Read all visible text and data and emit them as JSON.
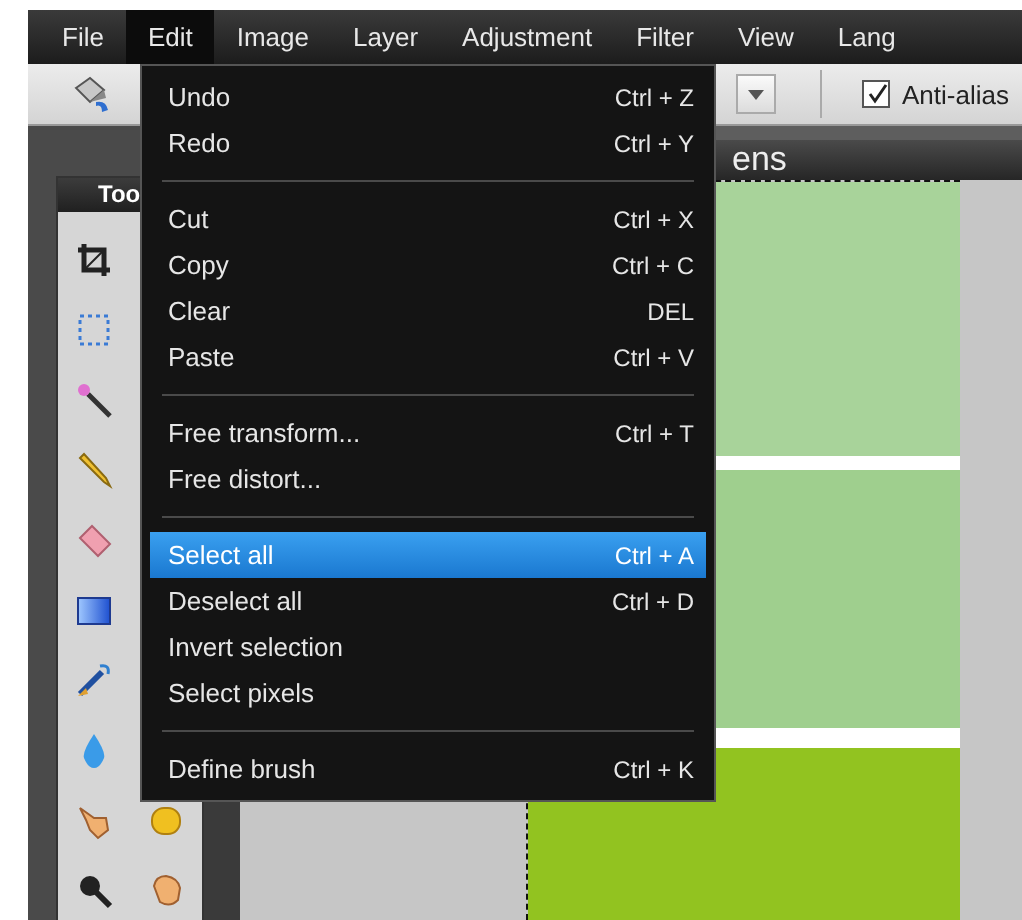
{
  "menu_bar": {
    "items": [
      {
        "label": "File",
        "selected": false
      },
      {
        "label": "Edit",
        "selected": true
      },
      {
        "label": "Image",
        "selected": false
      },
      {
        "label": "Layer",
        "selected": false
      },
      {
        "label": "Adjustment",
        "selected": false
      },
      {
        "label": "Filter",
        "selected": false
      },
      {
        "label": "View",
        "selected": false
      },
      {
        "label": "Lang",
        "selected": false
      }
    ]
  },
  "toolbar": {
    "anti_alias": {
      "label": "Anti-alias",
      "checked": true
    }
  },
  "tools_panel": {
    "title": "Too"
  },
  "document": {
    "title": "ens"
  },
  "edit_menu": {
    "items": [
      {
        "kind": "item",
        "label": "Undo",
        "shortcut": "Ctrl + Z",
        "selected": false
      },
      {
        "kind": "item",
        "label": "Redo",
        "shortcut": "Ctrl + Y",
        "selected": false
      },
      {
        "kind": "separator"
      },
      {
        "kind": "item",
        "label": "Cut",
        "shortcut": "Ctrl + X",
        "selected": false
      },
      {
        "kind": "item",
        "label": "Copy",
        "shortcut": "Ctrl + C",
        "selected": false
      },
      {
        "kind": "item",
        "label": "Clear",
        "shortcut": "DEL",
        "selected": false
      },
      {
        "kind": "item",
        "label": "Paste",
        "shortcut": "Ctrl + V",
        "selected": false
      },
      {
        "kind": "separator"
      },
      {
        "kind": "item",
        "label": "Free transform...",
        "shortcut": "Ctrl + T",
        "selected": false
      },
      {
        "kind": "item",
        "label": "Free distort...",
        "selected": false
      },
      {
        "kind": "separator"
      },
      {
        "kind": "item",
        "label": "Select all",
        "shortcut": "Ctrl + A",
        "selected": true
      },
      {
        "kind": "item",
        "label": "Deselect all",
        "shortcut": "Ctrl + D",
        "selected": false
      },
      {
        "kind": "item",
        "label": "Invert selection",
        "selected": false
      },
      {
        "kind": "item",
        "label": "Select pixels",
        "selected": false
      },
      {
        "kind": "separator"
      },
      {
        "kind": "item",
        "label": "Define brush",
        "shortcut": "Ctrl + K",
        "selected": false
      }
    ]
  }
}
